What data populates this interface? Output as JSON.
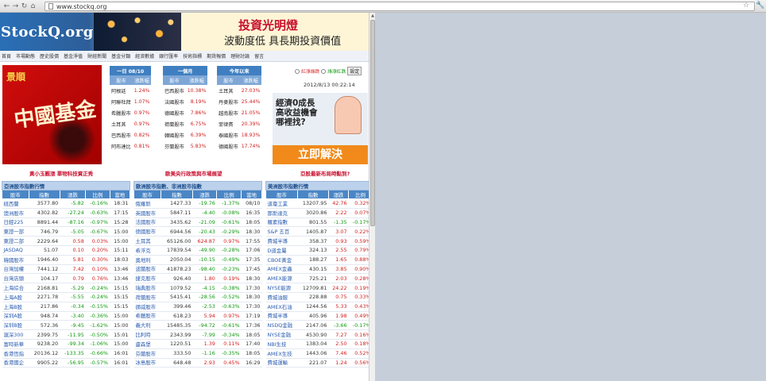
{
  "browser": {
    "url": "www.stockq.org"
  },
  "banner": {
    "logo": "StockQ.org",
    "ad_title": "投資光明燈",
    "ad_subtitle": "波動度低 具長期投資價值"
  },
  "menu": {
    "items": [
      "首頁",
      "市場動態",
      "歷史股價",
      "基金淨值",
      "財經新聞",
      "基金分類",
      "經濟數據",
      "銀行匯率",
      "技術指標",
      "期貨報價",
      "理財討論",
      "留言"
    ]
  },
  "left_ad": {
    "brand": "景順",
    "slogan": "中國基金"
  },
  "mini_tables": [
    {
      "title": "一日 08/10",
      "col1": "股市",
      "col2": "漲跌幅",
      "rows": [
        [
          "阿根廷",
          "1.24%"
        ],
        [
          "阿聯杜拜",
          "1.07%"
        ],
        [
          "希臘股市",
          "0.97%"
        ],
        [
          "土耳其",
          "0.97%"
        ],
        [
          "巴西股市",
          "0.82%"
        ],
        [
          "阿布達比",
          "0.81%"
        ]
      ]
    },
    {
      "title": "一個月",
      "col1": "股市",
      "col2": "漲跌幅",
      "rows": [
        [
          "巴西股市",
          "10.38%"
        ],
        [
          "法國股市",
          "8.19%"
        ],
        [
          "德國股市",
          "7.86%"
        ],
        [
          "荷蘭股市",
          "6.75%"
        ],
        [
          "韓國股市",
          "6.39%"
        ],
        [
          "芬蘭股市",
          "5.83%"
        ]
      ]
    },
    {
      "title": "今年以來",
      "col1": "股市",
      "col2": "漲跌幅",
      "rows": [
        [
          "土耳其",
          "27.03%"
        ],
        [
          "丹麥股市",
          "25.44%"
        ],
        [
          "越南股市",
          "21.05%"
        ],
        [
          "菲律賓",
          "20.39%"
        ],
        [
          "泰國股市",
          "18.93%"
        ],
        [
          "德國股市",
          "17.74%"
        ]
      ]
    }
  ],
  "radio": {
    "red": "紅漲綠跌",
    "green": "綠漲紅跌",
    "button": "設定"
  },
  "datetime": "2012/8/13 00:22:14",
  "right_ad": {
    "line1": "經濟0成長",
    "line2": "高收益機會",
    "line3": "哪裡找?",
    "button": "立即解決"
  },
  "links": [
    "黃小玉觀漲 單物科技資正秀",
    "歐美央行政策與市場展望",
    "亞股最新布局時點到?"
  ],
  "asia": {
    "title": "亞洲股市指數行情",
    "headers": [
      "股市",
      "指數",
      "漲跌",
      "比例",
      "當地"
    ],
    "rows": [
      [
        "紐西蘭",
        "3577.80",
        "-5.82",
        "-0.16%",
        "18:31"
      ],
      [
        "澳洲股市",
        "4302.82",
        "-27.24",
        "-0.63%",
        "17:15"
      ],
      [
        "日經225",
        "8891.44",
        "-87.16",
        "-0.97%",
        "15:28"
      ],
      [
        "東證一部",
        "746.79",
        "-5.05",
        "-0.67%",
        "15:00"
      ],
      [
        "東證二部",
        "2229.64",
        "0.58",
        "0.03%",
        "15:00"
      ],
      [
        "JASDAQ",
        "51.07",
        "0.10",
        "0.20%",
        "15:11"
      ],
      [
        "韓國股市",
        "1946.40",
        "5.81",
        "0.30%",
        "18:03"
      ],
      [
        "台灣加權",
        "7441.12",
        "7.42",
        "0.10%",
        "13:46"
      ],
      [
        "台灣店頭",
        "104.17",
        "0.79",
        "0.76%",
        "13:46"
      ],
      [
        "上海綜合",
        "2168.81",
        "-5.29",
        "-0.24%",
        "15:15"
      ],
      [
        "上海A股",
        "2271.78",
        "-5.55",
        "-0.24%",
        "15:15"
      ],
      [
        "上海B股",
        "217.86",
        "-0.34",
        "-0.15%",
        "15:15"
      ],
      [
        "深圳A股",
        "948.74",
        "-3.40",
        "-0.36%",
        "15:00"
      ],
      [
        "深圳B股",
        "572.36",
        "-9.45",
        "-1.62%",
        "15:00"
      ],
      [
        "滬深300",
        "2399.75",
        "-11.95",
        "-0.50%",
        "15:01"
      ],
      [
        "富時新華",
        "9238.20",
        "-99.34",
        "-1.06%",
        "15:00"
      ],
      [
        "香港恆指",
        "20136.12",
        "-133.35",
        "-0.66%",
        "16:01"
      ],
      [
        "香港國企",
        "9905.22",
        "-56.95",
        "-0.57%",
        "16:01"
      ]
    ]
  },
  "europe": {
    "title": "歐洲股市指數、非洲股市指數",
    "headers": [
      "股市",
      "指數",
      "漲跌",
      "比例",
      "當地"
    ],
    "rows": [
      [
        "俄羅斯",
        "1427.33",
        "-19.76",
        "-1.37%",
        "08/10"
      ],
      [
        "英國股市",
        "5847.11",
        "-4.40",
        "-0.08%",
        "16:35"
      ],
      [
        "法國股市",
        "3435.62",
        "-21.09",
        "-0.61%",
        "18:05"
      ],
      [
        "德國股市",
        "6944.56",
        "-20.43",
        "-0.29%",
        "18:30"
      ],
      [
        "土耳其",
        "65126.00",
        "624.87",
        "0.97%",
        "17:55"
      ],
      [
        "希浮克",
        "17839.54",
        "-49.90",
        "-0.28%",
        "17:06"
      ],
      [
        "奧地利",
        "2050.04",
        "-10.15",
        "-0.49%",
        "17:35"
      ],
      [
        "波蘭股市",
        "41878.23",
        "-98.40",
        "-0.23%",
        "17:45"
      ],
      [
        "捷克股市",
        "926.40",
        "1.80",
        "0.19%",
        "18:30"
      ],
      [
        "瑞典股市",
        "1079.52",
        "-4.15",
        "-0.38%",
        "17:30"
      ],
      [
        "荷蘭股市",
        "5415.41",
        "-28.56",
        "-0.52%",
        "18:30"
      ],
      [
        "挪威股市",
        "399.46",
        "-2.53",
        "-0.63%",
        "17:30"
      ],
      [
        "希臘股市",
        "618.23",
        "5.94",
        "0.97%",
        "17:19"
      ],
      [
        "義大利",
        "15485.35",
        "-94.72",
        "-0.61%",
        "17:36"
      ],
      [
        "比利時",
        "2343.99",
        "-7.99",
        "-0.34%",
        "18:05"
      ],
      [
        "盧森堡",
        "1220.51",
        "1.39",
        "0.11%",
        "17:40"
      ],
      [
        "芬蘭股市",
        "333.50",
        "-1.16",
        "-0.35%",
        "18:05"
      ],
      [
        "冰島股市",
        "648.48",
        "2.93",
        "0.45%",
        "16:29"
      ]
    ]
  },
  "america": {
    "title": "美洲股市指數行情",
    "headers": [
      "股市",
      "指數",
      "漲跌",
      "比例"
    ],
    "rows": [
      [
        "道瓊工業",
        "13207.95",
        "42.76",
        "0.32%"
      ],
      [
        "那斯達克",
        "3020.86",
        "2.22",
        "0.07%"
      ],
      [
        "羅素指數",
        "801.55",
        "-1.35",
        "-0.17%"
      ],
      [
        "S&P 五百",
        "1405.87",
        "3.07",
        "0.22%"
      ],
      [
        "費城半導",
        "358.37",
        "0.93",
        "0.59%"
      ],
      [
        "D道金屬",
        "324.13",
        "2.55",
        "0.79%"
      ],
      [
        "CBOE黃金",
        "188.27",
        "1.65",
        "0.88%"
      ],
      [
        "AMEX金蟲",
        "430.15",
        "3.85",
        "0.90%"
      ],
      [
        "AMEX能源",
        "725.21",
        "2.03",
        "0.28%"
      ],
      [
        "NYSE能源",
        "12709.81",
        "24.22",
        "0.19%"
      ],
      [
        "費城油服",
        "228.88",
        "0.75",
        "0.33%"
      ],
      [
        "AMEX石油",
        "1244.56",
        "5.33",
        "0.43%"
      ],
      [
        "費城半導",
        "405.96",
        "1.98",
        "0.49%"
      ],
      [
        "NSDQ金融",
        "2147.06",
        "-3.66",
        "-0.17%"
      ],
      [
        "NYSE金融",
        "4530.90",
        "7.27",
        "0.16%"
      ],
      [
        "NBI生技",
        "1383.04",
        "2.50",
        "0.18%"
      ],
      [
        "AMEX生技",
        "1443.06",
        "7.46",
        "0.52%"
      ],
      [
        "費城運輸",
        "221.07",
        "1.24",
        "0.56%"
      ]
    ]
  }
}
